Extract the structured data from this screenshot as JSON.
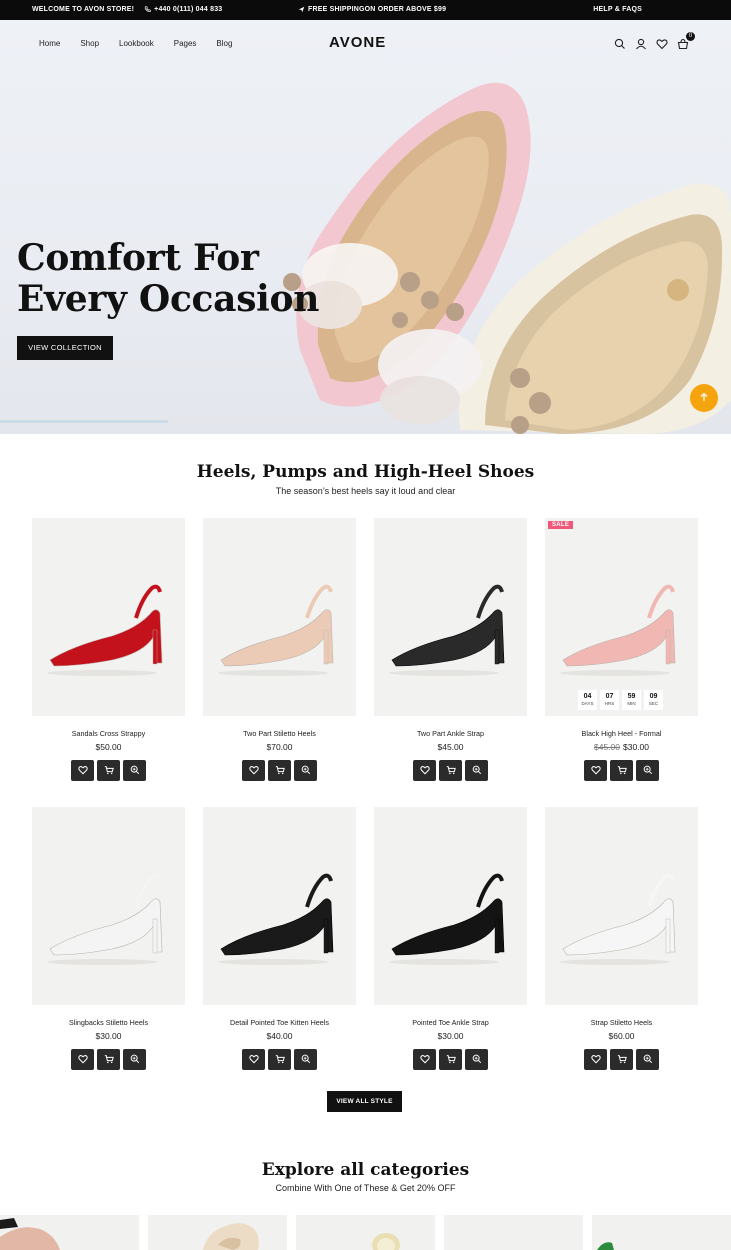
{
  "topbar": {
    "welcome": "WELCOME TO AVON STORE!",
    "phone": "+440 0(111) 044 833",
    "shipping": "FREE SHIPPINGON ORDER ABOVE $99",
    "help": "HELP & FAQS"
  },
  "header": {
    "nav": [
      "Home",
      "Shop",
      "Lookbook",
      "Pages",
      "Blog"
    ],
    "logo": "AVONE",
    "icons": [
      "search-icon",
      "user-icon",
      "heart-icon",
      "cart-icon"
    ],
    "cart_count": "0"
  },
  "hero": {
    "title_line1": "Comfort For",
    "title_line2": "Every Occasion",
    "button": "VIEW COLLECTION",
    "scroll_top_color": "#f5a40d"
  },
  "heels_section": {
    "title": "Heels, Pumps and High-Heel Shoes",
    "subtitle": "The season’s best heels say it loud and clear",
    "products": [
      {
        "name": "Sandals Cross Strappy",
        "price": "$50.00",
        "old_price": "",
        "shoe_color": "#c4121c"
      },
      {
        "name": "Two Part Stiletto Heels",
        "price": "$70.00",
        "old_price": "",
        "shoe_color": "#eccbb6"
      },
      {
        "name": "Two Part Ankle Strap",
        "price": "$45.00",
        "old_price": "",
        "shoe_color": "#2a2a2a"
      },
      {
        "name": "Black High Heel - Formal",
        "price": "$30.00",
        "old_price": "$45.00",
        "shoe_color": "#f0b7b3",
        "badge": "SALE",
        "countdown": [
          {
            "value": "04",
            "label": "DAYS"
          },
          {
            "value": "07",
            "label": "HRS"
          },
          {
            "value": "59",
            "label": "MIN"
          },
          {
            "value": "09",
            "label": "SEC"
          }
        ]
      },
      {
        "name": "Slingbacks Stiletto Heels",
        "price": "$30.00",
        "old_price": "",
        "shoe_color": "#f4f4f4"
      },
      {
        "name": "Detail Pointed Toe Kitten Heels",
        "price": "$40.00",
        "old_price": "",
        "shoe_color": "#1a1a1a"
      },
      {
        "name": "Pointed Toe Ankle Strap",
        "price": "$30.00",
        "old_price": "",
        "shoe_color": "#141414"
      },
      {
        "name": "Strap Stiletto Heels",
        "price": "$60.00",
        "old_price": "",
        "shoe_color": "#f6f6f6"
      }
    ],
    "view_all": "VIEW ALL STYLE"
  },
  "categories_section": {
    "title": "Explore all categories",
    "subtitle": "Combine With One of These & Get 20% OFF"
  }
}
